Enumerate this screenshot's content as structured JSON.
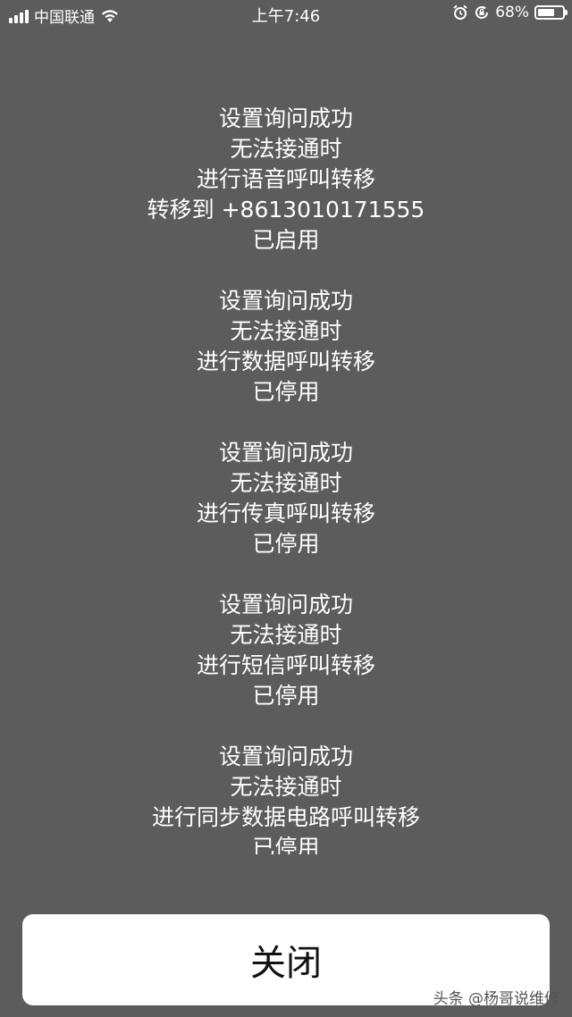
{
  "status_bar": {
    "carrier": "中国联通",
    "time": "上午7:46",
    "battery_text": "68%",
    "battery_level": 0.68,
    "icons": [
      "signal-icon",
      "wifi-icon",
      "alarm-icon",
      "rotation-lock-icon",
      "battery-icon"
    ]
  },
  "message": {
    "blocks": [
      {
        "lines": [
          "设置询问成功",
          "无法接通时",
          "进行语音呼叫转移",
          "转移到 +8613010171555",
          "已启用"
        ]
      },
      {
        "lines": [
          "设置询问成功",
          "无法接通时",
          "进行数据呼叫转移",
          "已停用"
        ]
      },
      {
        "lines": [
          "设置询问成功",
          "无法接通时",
          "进行传真呼叫转移",
          "已停用"
        ]
      },
      {
        "lines": [
          "设置询问成功",
          "无法接通时",
          "进行短信呼叫转移",
          "已停用"
        ]
      },
      {
        "lines": [
          "设置询问成功",
          "无法接通时",
          "进行同步数据电路呼叫转移",
          "已停用"
        ]
      }
    ]
  },
  "close_button": {
    "label": "关闭"
  },
  "watermark": "头条 @杨哥说维修",
  "colors": {
    "background": "#5c5c5c",
    "text": "#ffffff",
    "button_bg": "#ffffff",
    "button_text": "#111111"
  }
}
